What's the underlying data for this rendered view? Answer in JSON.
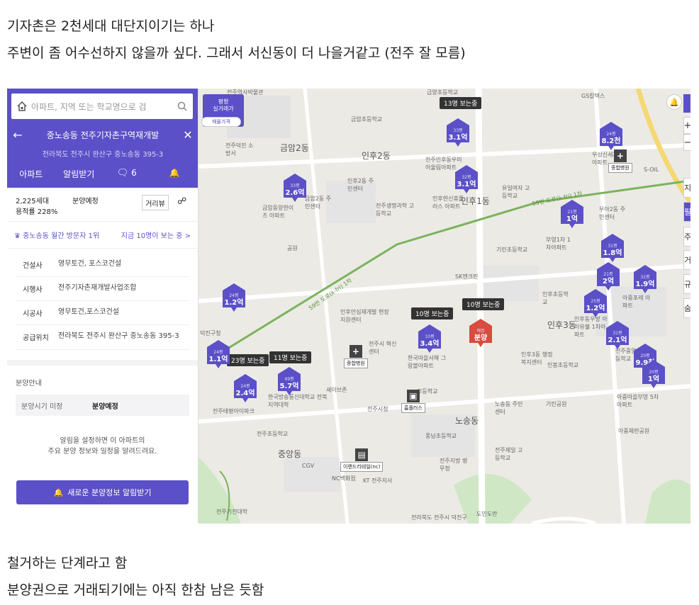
{
  "post": {
    "line1": "기자촌은 2천세대 대단지이기는 하나",
    "line2": "주변이 좀 어수선하지 않을까 싶다. 그래서 서신동이 더 나을거같고 (전주 잘 모름)",
    "line3": "철거하는 단계라고 함",
    "line4": "분양권으로 거래되기에는 아직 한참 남은 듯함"
  },
  "panel": {
    "search_placeholder": "아파트, 지역 또는 학교명으로 검",
    "title": "중노송동 전주기자촌구역재개발",
    "address": "전라북도 전주시 완산구 중노송동 395-3",
    "tabs": {
      "apartment": "아파트",
      "alert": "알림받기",
      "comment_count": "6"
    },
    "households": "2,225세대",
    "ratio": "용적률 228%",
    "status": "분양예정",
    "distance_btn": "거리뷰",
    "visit_rank": "중노송동 월간 방문자 1위",
    "viewing_now": "지금 10명이 보는 중 >",
    "info": [
      {
        "key": "건설사",
        "value": "영무토건, 포스코건설"
      },
      {
        "key": "시행사",
        "value": "전주기자촌재개발사업조합"
      },
      {
        "key": "시공사",
        "value": "영무토건,포스코건설"
      },
      {
        "key": "공급위치",
        "value": "전라북도 전주시 완산구 중노송동 395-3"
      }
    ],
    "section": "분양안내",
    "sched_key": "분양시기 미정",
    "sched_val": "분양예정",
    "note1": "알림을 설정하면 이 아파트의",
    "note2": "주요 분양 정보와 일정을 알려드려요.",
    "cta": "새로운 분양정보 알림받기"
  },
  "map": {
    "filter_top": "평형",
    "filter_mid": "실거래가",
    "filter_bot": "매물가격",
    "labels": [
      "금암2동",
      "인후2동",
      "인후1동",
      "인후3동",
      "노송동",
      "중앙동"
    ],
    "small_labels": [
      "전주역사박물관",
      "금암초등학교",
      "금양초등학교",
      "인후2동 주민센터",
      "전주생명과학 고등학교",
      "금암2동 주민센터",
      "금암동양한이츠 아파트",
      "공원",
      "기린초등학교",
      "SK엔크린",
      "인후안심재개발 현장지원센터",
      "전주시 혁신센터",
      "한국마을서해 그랑블아파트",
      "세이브존",
      "전주시청",
      "전주초등학교",
      "CGV",
      "NC백화점",
      "KT 전주지사",
      "한국방송통신대학교 전북지역대학",
      "전주태평아이파크",
      "노송동 주민센터",
      "풍남초등학교",
      "전주제일 고등학교",
      "전주지방 병무청",
      "인후초등학교",
      "아중마을부영 5차아파트",
      "아중체련공원",
      "기린공원",
      "도민도란",
      "전주기전대학",
      "부영1차 1차아파트",
      "인후동우방 아이유쉘 1차아파트",
      "아중포레 아파트",
      "인봉초등학교",
      "인후3동 행정복지센터",
      "전주중앙 고등학교",
      "우아2동 주민센터",
      "유일여자 고등학교",
      "인후한신휴플러스 아파트",
      "전주인후동우미 어울림아파트",
      "GS칼텍스",
      "전주덕진 소방서",
      "우성신세계 아파트",
      "S-OIL",
      "덕진구청",
      "고등학교"
    ],
    "pins": [
      {
        "py": "33평",
        "pv": "3.1억"
      },
      {
        "py": "24평",
        "pv": "8.2천"
      },
      {
        "py": "33평",
        "pv": "2.6억"
      },
      {
        "py": "32평",
        "pv": "3.1억"
      },
      {
        "py": "21평",
        "pv": "1억"
      },
      {
        "py": "31평",
        "pv": "1.8억"
      },
      {
        "py": "21평",
        "pv": "2억"
      },
      {
        "py": "32평",
        "pv": "1.9억"
      },
      {
        "py": "25평",
        "pv": "1.2억"
      },
      {
        "py": "31평",
        "pv": "2.1억"
      },
      {
        "py": "24평",
        "pv": "1.2억"
      },
      {
        "py": "33평",
        "pv": "3.4억"
      },
      {
        "py": "24평",
        "pv": "1.1억"
      },
      {
        "py": "49평",
        "pv": "5.7억"
      },
      {
        "py": "24평",
        "pv": "2.4억"
      },
      {
        "py": "20평",
        "pv": "9.9천"
      },
      {
        "py": "20평",
        "pv": "1억"
      }
    ],
    "red_pin": {
      "py": "예정",
      "pv": "분양"
    },
    "bubbles": [
      "13명 보는중",
      "10명 보는중",
      "10명 보는중",
      "23명 보는중",
      "11명 보는중"
    ],
    "facilities": [
      "종합병원",
      "종합병원",
      "홈플러스",
      "이랜드리테일(nc)"
    ],
    "controls": {
      "plus": "+",
      "minus": "−"
    },
    "right_edge": [
      "지",
      "필",
      "주",
      "거",
      "규",
      "숨"
    ],
    "road_labels": [
      "59번 도로(k-fri) 1차",
      "59번 도로(k-fri) 1차"
    ],
    "bottom_note": "전라북도 전주시 덕진구"
  },
  "colors": {
    "purple": "#5b50c7",
    "pin": "#5b50c7",
    "red": "#d94b3f"
  }
}
